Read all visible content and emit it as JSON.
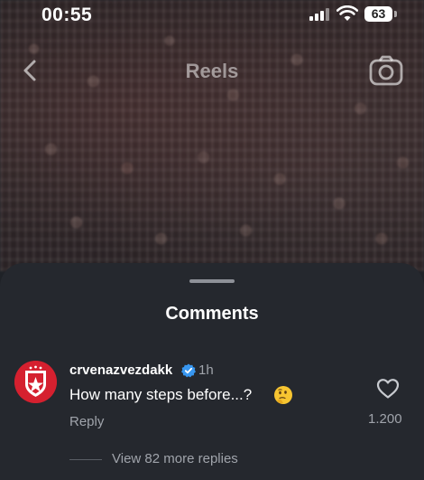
{
  "status_bar": {
    "time": "00:55",
    "battery": "63"
  },
  "header": {
    "title": "Reels"
  },
  "comments_sheet": {
    "title": "Comments",
    "comments": [
      {
        "username": "crvenazvezdakk",
        "verified": true,
        "time_ago": "1h",
        "text": "How many steps before...?",
        "reply_label": "Reply",
        "likes": "1.200",
        "view_replies": "View 82 more replies"
      }
    ]
  },
  "colors": {
    "sheet_bg": "#25282e",
    "muted_text": "#a0a4ab",
    "verified_blue": "#3897f0",
    "avatar_red": "#d5202f"
  },
  "icons": [
    "back-chevron-icon",
    "camera-icon",
    "verified-badge-icon",
    "thinking-emoji-icon",
    "heart-icon",
    "wifi-icon",
    "signal-icon",
    "battery-icon"
  ]
}
